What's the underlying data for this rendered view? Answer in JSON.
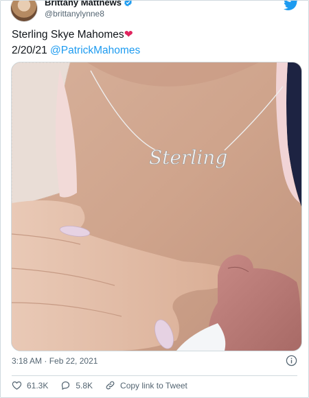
{
  "author": {
    "display_name": "Brittany Matthews",
    "handle": "@brittanylynne8"
  },
  "tweet": {
    "line1": "Sterling Skye Mahomes",
    "emoji": "❤",
    "line2_date": "2/20/21",
    "mention": "@PatrickMahomes"
  },
  "photo": {
    "necklace_text": "Sterling"
  },
  "meta": {
    "timestamp": "3:18 AM · Feb 22, 2021"
  },
  "actions": {
    "likes": "61.3K",
    "replies": "5.8K",
    "copy_link": "Copy link to Tweet"
  },
  "colors": {
    "accent": "#1d9bf0",
    "heart": "#e0245e",
    "muted": "#536471"
  }
}
